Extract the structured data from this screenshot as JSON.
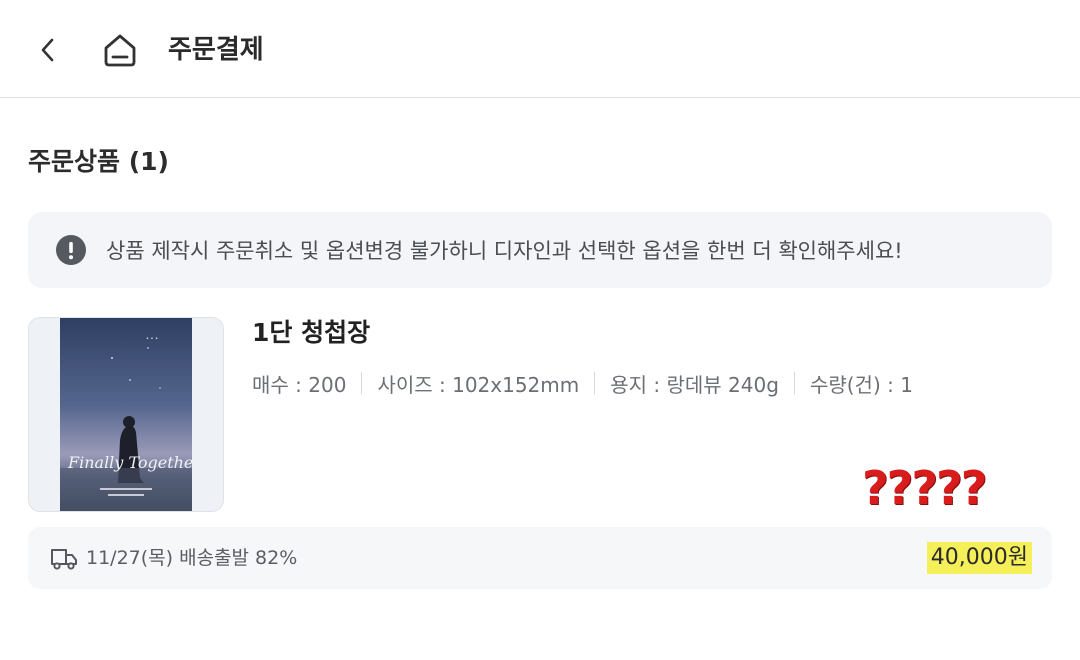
{
  "header": {
    "back_icon": "chevron-left-icon",
    "home_icon": "home-icon",
    "title": "주문결제"
  },
  "section": {
    "title": "주문상품 (1)"
  },
  "notice": {
    "icon": "exclamation-circle-icon",
    "text": "상품 제작시 주문취소 및 옵션변경 불가하니 디자인과 선택한 옵션을 한번 더 확인해주세요!"
  },
  "product": {
    "name": "1단 청첩장",
    "thumbnail_text": "Finally Together",
    "specs": [
      "매수 : 200",
      "사이즈 : 102x152mm",
      "용지 : 랑데뷰 240g",
      "수량(건) : 1"
    ]
  },
  "annotation": {
    "text": "?????",
    "color": "#d81b1b"
  },
  "delivery": {
    "icon": "truck-icon",
    "text": "11/27(목) 배송출발 82%",
    "price": "40,000원",
    "price_highlight": "#f5f05a"
  }
}
